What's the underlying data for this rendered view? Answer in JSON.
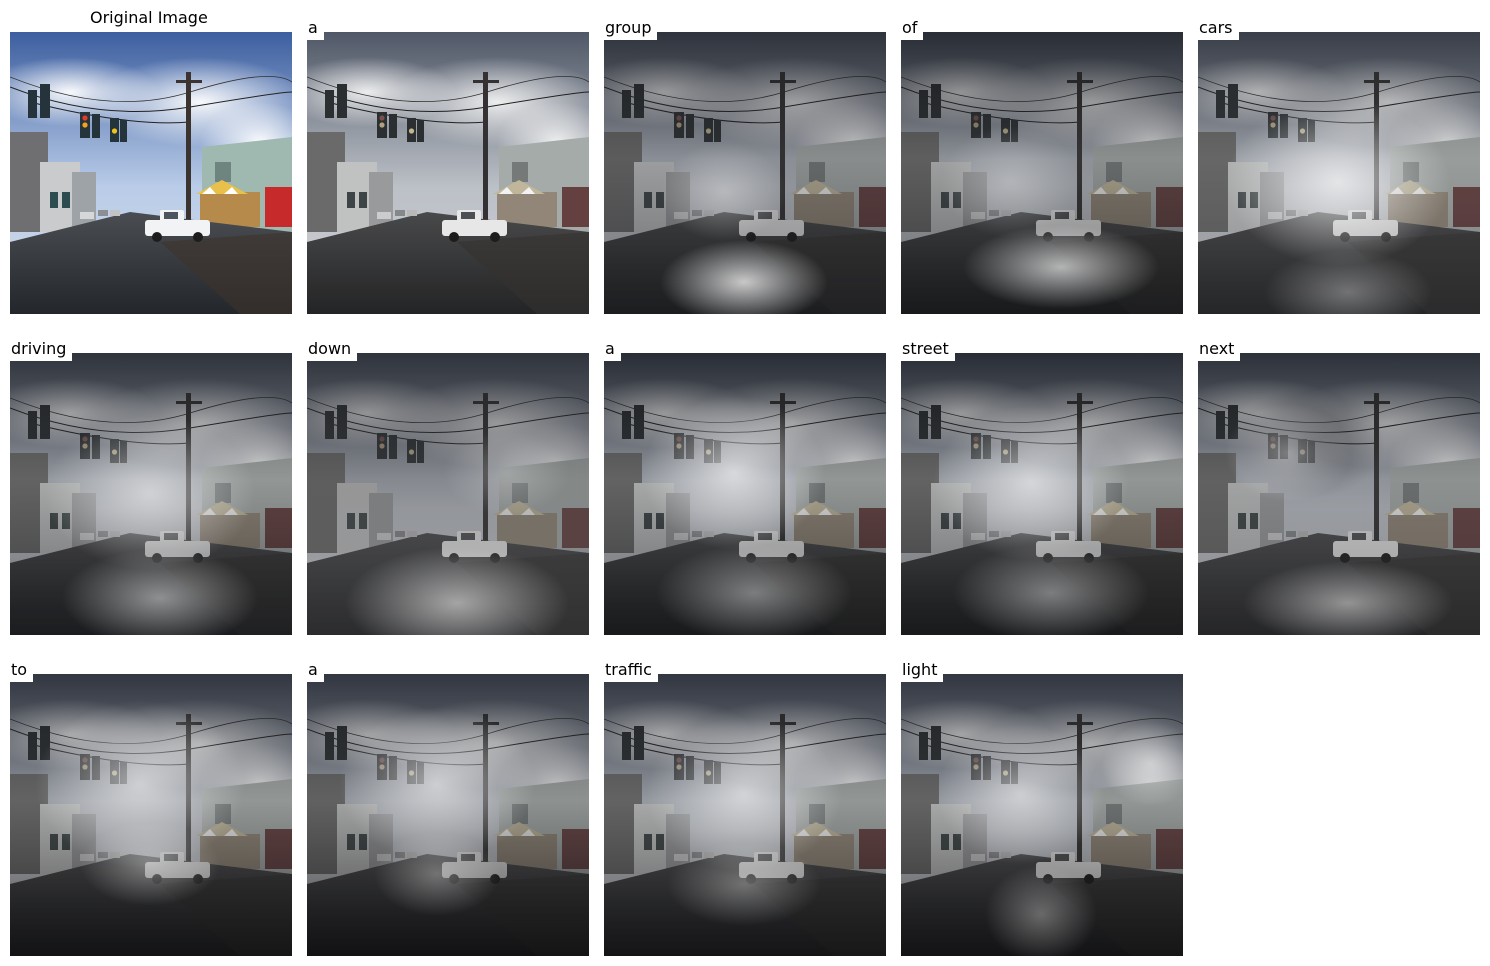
{
  "original_title": "Original Image",
  "caption_words": [
    "a",
    "group",
    "of",
    "cars",
    "driving",
    "down",
    "a",
    "street",
    "next",
    "to",
    "a",
    "traffic",
    "light"
  ],
  "colors": {
    "sky_top": "#3d5fa0",
    "sky_mid": "#b9cce8",
    "cloud": "#eef3fb",
    "road": "#2b2e33",
    "building_green": "#9fb8b0",
    "awning_yellow": "#e8c04a",
    "red_trailer": "#c62a2a"
  }
}
